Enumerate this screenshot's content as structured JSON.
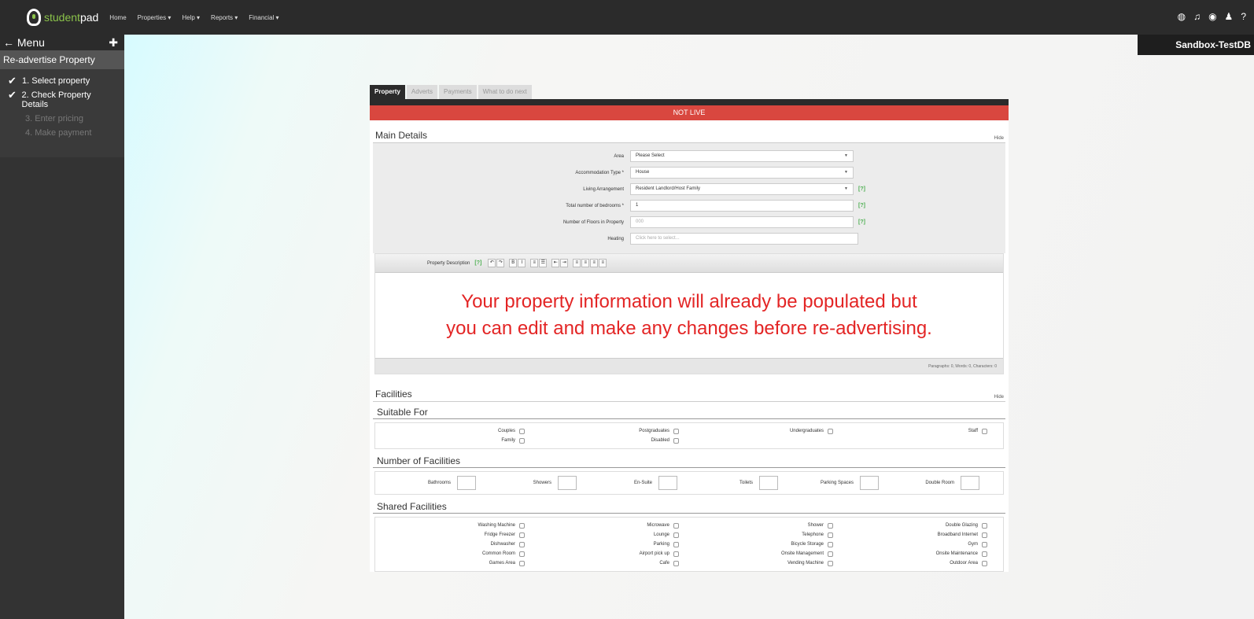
{
  "topbar": {
    "logo_prefix": "student",
    "logo_suffix": "pad",
    "nav": [
      "Home",
      "Properties ▾",
      "Help ▾",
      "Reports ▾",
      "Financial ▾"
    ],
    "icons": [
      "globe-icon",
      "bell-icon",
      "eye-icon",
      "user-icon",
      "help-icon"
    ]
  },
  "sandbox_label": "Sandbox-TestDB",
  "sidebar": {
    "menu_label": "← Menu",
    "pin_icon": "pin-icon",
    "title": "Re-advertise Property",
    "steps": [
      {
        "label": "1. Select property",
        "done": true
      },
      {
        "label": "2. Check Property Details",
        "done": true
      },
      {
        "label": "3. Enter pricing",
        "done": false
      },
      {
        "label": "4. Make payment",
        "done": false
      }
    ]
  },
  "tabs": [
    "Property",
    "Adverts",
    "Payments",
    "What to do next"
  ],
  "status_banner": "NOT LIVE",
  "main_details": {
    "title": "Main Details",
    "hide": "Hide",
    "fields": {
      "area": {
        "label": "Area",
        "value": "Please Select"
      },
      "accommodation": {
        "label": "Accommodation Type *",
        "value": "House"
      },
      "living": {
        "label": "Living Arrangement",
        "value": "Resident Landlord/Host Family",
        "hint": "[?]"
      },
      "bedrooms": {
        "label": "Total number of bedrooms *",
        "value": "1",
        "hint": "[?]"
      },
      "floors": {
        "label": "Number of Floors in Property",
        "placeholder": "000",
        "hint": "[?]"
      },
      "heating": {
        "label": "Heating",
        "placeholder": "Click here to select..."
      }
    },
    "description_label": "Property Description",
    "description_hint": "[?]",
    "overlay_line1": "Your property information will already be populated but",
    "overlay_line2": "you can edit and make any changes before re-advertising.",
    "word_count": "Paragraphs: 0, Words: 0, Characters: 0"
  },
  "facilities": {
    "title": "Facilities",
    "hide": "Hide",
    "suitable_title": "Suitable For",
    "suitable": [
      [
        "Couples",
        "Postgraduates",
        "Undergraduates",
        "Staff"
      ],
      [
        "Family",
        "Disabled"
      ]
    ],
    "number_title": "Number of Facilities",
    "number": [
      "Bathrooms",
      "Showers",
      "En-Suite",
      "Toilets",
      "Parking Spaces",
      "Double Room"
    ],
    "shared_title": "Shared Facilities",
    "shared": [
      [
        "Washing Machine",
        "Microwave",
        "Shower",
        "Double Glazing"
      ],
      [
        "Fridge Freezer",
        "Lounge",
        "Telephone",
        "Broadband Internet"
      ],
      [
        "Dishwasher",
        "Parking",
        "Bicycle Storage",
        "Gym"
      ],
      [
        "Common Room",
        "Airport pick up",
        "Onsite Management",
        "Onsite Maintenance"
      ],
      [
        "Games Area",
        "Cafe",
        "Vending Machine",
        "Outdoor Area"
      ]
    ]
  }
}
